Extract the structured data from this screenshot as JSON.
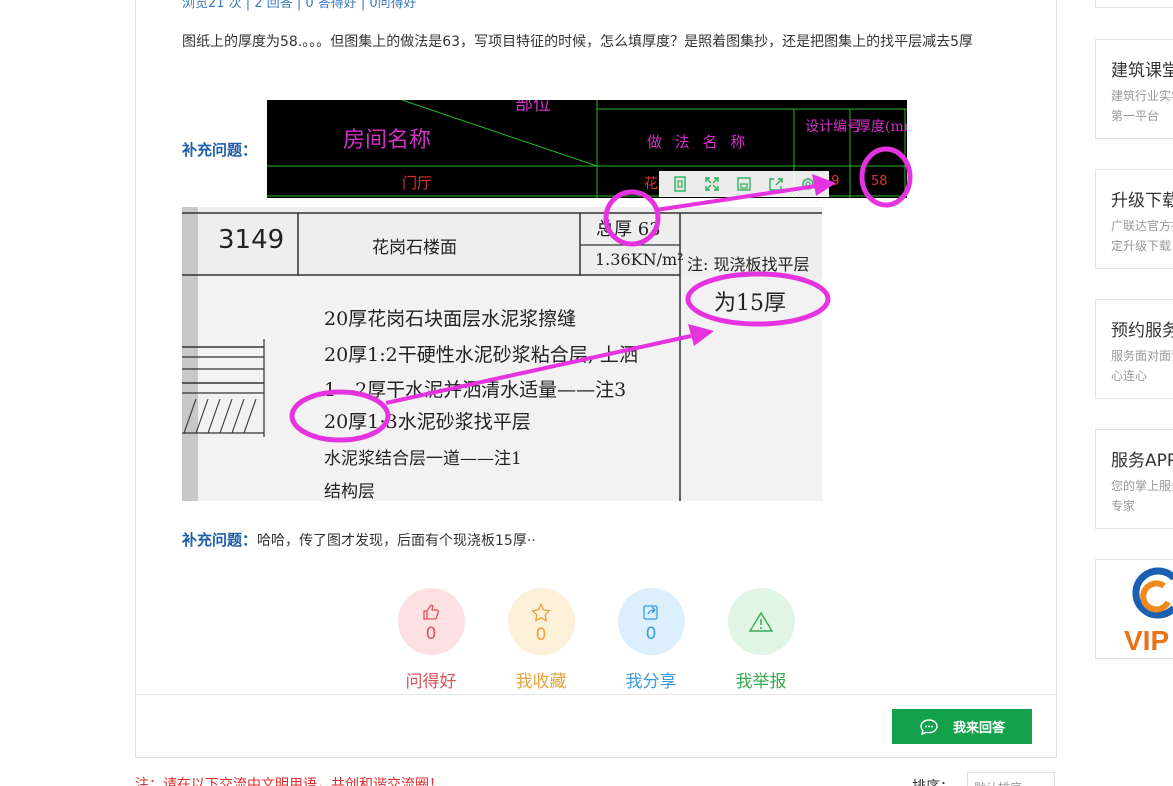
{
  "question": {
    "stats": "浏览21 次 | 2 回答 | 0 答得好 | 0问得好",
    "text": "图纸上的厚度为58.。。。但图集上的做法是63，写项目特征的时候，怎么填厚度？是照着图集抄，还是把图集上的找平层减去5厚",
    "supplement1_label": "补充问题：",
    "supplement2_label": "补充问题：",
    "supplement2_text": "哈哈，传了图才发现，后面有个现浇板15厚··"
  },
  "cad_image": {
    "part": "部位",
    "room_name": "房间名称",
    "method_name": "做 法 名 称",
    "design_code": "设计编号",
    "thickness": "厚度(mm)",
    "room": "门厅",
    "method_partial": "花",
    "code_value": "49",
    "thickness_value": "58"
  },
  "scan_image": {
    "code": "3149",
    "title": "花岗石楼面",
    "total_thickness": "总厚 63",
    "load": "1.36KN/m²",
    "note": "注: 现浇板找平层",
    "note2": "为15厚",
    "lines": [
      "20厚花岗石块面层水泥浆擦缝",
      "20厚1:2干硬性水泥砂浆粘合层, 上洒",
      "1—2厚干水泥并洒清水适量——注3",
      "20厚1:3水泥砂浆找平层",
      "水泥浆结合层一道——注1",
      "结构层"
    ]
  },
  "actions": [
    {
      "label": "问得好",
      "count": "0",
      "icon": "thumbs-up-icon",
      "color": "#e0525e",
      "bg": "#fde0e2"
    },
    {
      "label": "我收藏",
      "count": "0",
      "icon": "star-icon",
      "color": "#e6a33d",
      "bg": "#fdf0d8"
    },
    {
      "label": "我分享",
      "count": "0",
      "icon": "share-icon",
      "color": "#3d9be0",
      "bg": "#dbeffc"
    },
    {
      "label": "我举报",
      "count": "0",
      "icon": "warning-icon",
      "color": "#3aaa55",
      "bg": "#e0f5e4"
    }
  ],
  "answer_button": "我来回答",
  "notice": "注：请在以下交流中文明用语，共创和谐交流圈！",
  "sort": {
    "label": "排序：",
    "value": "默认排序"
  },
  "sidebar": [
    {
      "title": "建筑课堂",
      "desc": "建筑行业实学第一平台"
    },
    {
      "title": "升级下载",
      "desc": "广联达官方指定升级下载"
    },
    {
      "title": "预约服务",
      "desc": "服务面对面诺心连心"
    },
    {
      "title": "服务APP",
      "desc": "您的掌上服务专家"
    }
  ],
  "vip_logo": "VIP",
  "colors": {
    "accent_blue": "#1f5fa8",
    "answer_green": "#13a24b",
    "annotation_magenta": "#e633e0",
    "notice_red": "#e02e2e"
  }
}
